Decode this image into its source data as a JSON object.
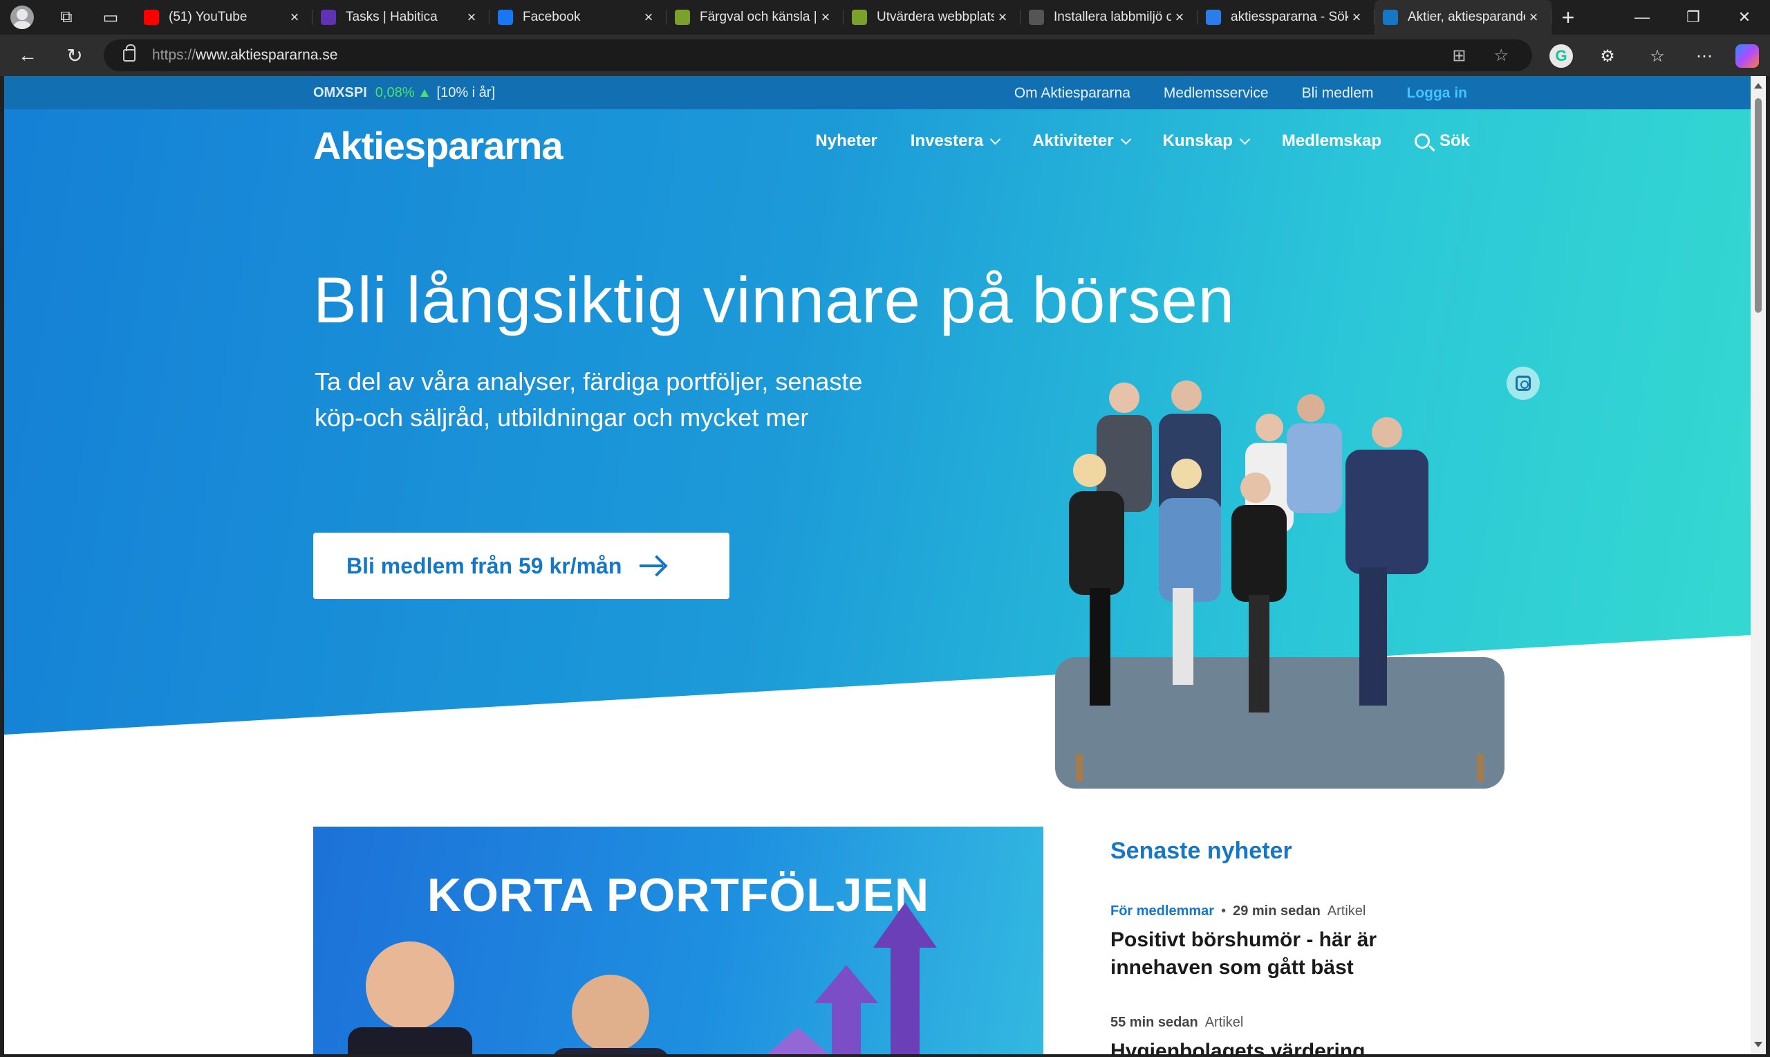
{
  "browser": {
    "tabs": [
      {
        "title": "(51) YouTube",
        "favicon": "youtube-icon",
        "color": "#ff0000"
      },
      {
        "title": "Tasks | Habitica",
        "favicon": "habitica-icon",
        "color": "#6133b4"
      },
      {
        "title": "Facebook",
        "favicon": "facebook-icon",
        "color": "#1877f2"
      },
      {
        "title": "Färgval och känsla | Á",
        "favicon": "leaf-icon",
        "color": "#7aa12b"
      },
      {
        "title": "Utvärdera webbplats",
        "favicon": "leaf-icon",
        "color": "#7aa12b"
      },
      {
        "title": "Installera labbmiljö o",
        "favicon": "github-icon",
        "color": "#555555"
      },
      {
        "title": "aktiesspararna - Sök",
        "favicon": "search-icon",
        "color": "#2b7de9"
      },
      {
        "title": "Aktier, aktiesparande",
        "favicon": "aktiespararna-icon",
        "color": "#1577c5",
        "active": true
      }
    ],
    "url_protocol": "https://",
    "url_host": "www.aktiespararna.se"
  },
  "topstrip": {
    "index_name": "OMXSPI",
    "index_change": "0,08%",
    "index_year": "[10% i år]",
    "links": [
      "Om Aktiespararna",
      "Medlemsservice",
      "Bli medlem"
    ],
    "login": "Logga in"
  },
  "header": {
    "logo": "Aktiespararna",
    "nav": [
      {
        "label": "Nyheter",
        "dropdown": false
      },
      {
        "label": "Investera",
        "dropdown": true
      },
      {
        "label": "Aktiviteter",
        "dropdown": true
      },
      {
        "label": "Kunskap",
        "dropdown": true
      },
      {
        "label": "Medlemskap",
        "dropdown": false
      }
    ],
    "search_label": "Sök"
  },
  "hero": {
    "headline": "Bli långsiktig vinnare på börsen",
    "subline_1": "Ta del av våra analyser, färdiga portföljer, senaste",
    "subline_2": "köp-och säljråd, utbildningar och mycket mer",
    "cta": "Bli medlem från 59 kr/mån"
  },
  "feature": {
    "title": "KORTA PORTFÖLJEN"
  },
  "news": {
    "heading": "Senaste nyheter",
    "items": [
      {
        "members": "För medlemmar",
        "time": "29 min sedan",
        "type": "Artikel",
        "title": "Positivt börshumör - här är innehaven som gått bäst"
      },
      {
        "members": "",
        "time": "55 min sedan",
        "type": "Artikel",
        "title": "Hygienbolagets värdering"
      }
    ]
  },
  "colors": {
    "brand_blue": "#1577c5",
    "positive_green": "#4ee06a"
  }
}
